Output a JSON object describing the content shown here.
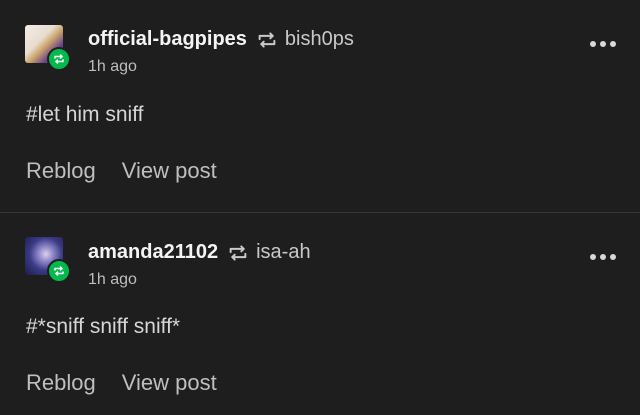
{
  "posts": [
    {
      "username": "official-bagpipes",
      "source": "bish0ps",
      "time": "1h ago",
      "tag": "#let him sniff",
      "actions": {
        "reblog": "Reblog",
        "view_post": "View post"
      }
    },
    {
      "username": "amanda21102",
      "source": "isa-ah",
      "time": "1h ago",
      "tag": "#*sniff sniff sniff*",
      "actions": {
        "reblog": "Reblog",
        "view_post": "View post"
      }
    }
  ],
  "colors": {
    "badge": "#00b84c",
    "background": "#1e1e1e"
  }
}
